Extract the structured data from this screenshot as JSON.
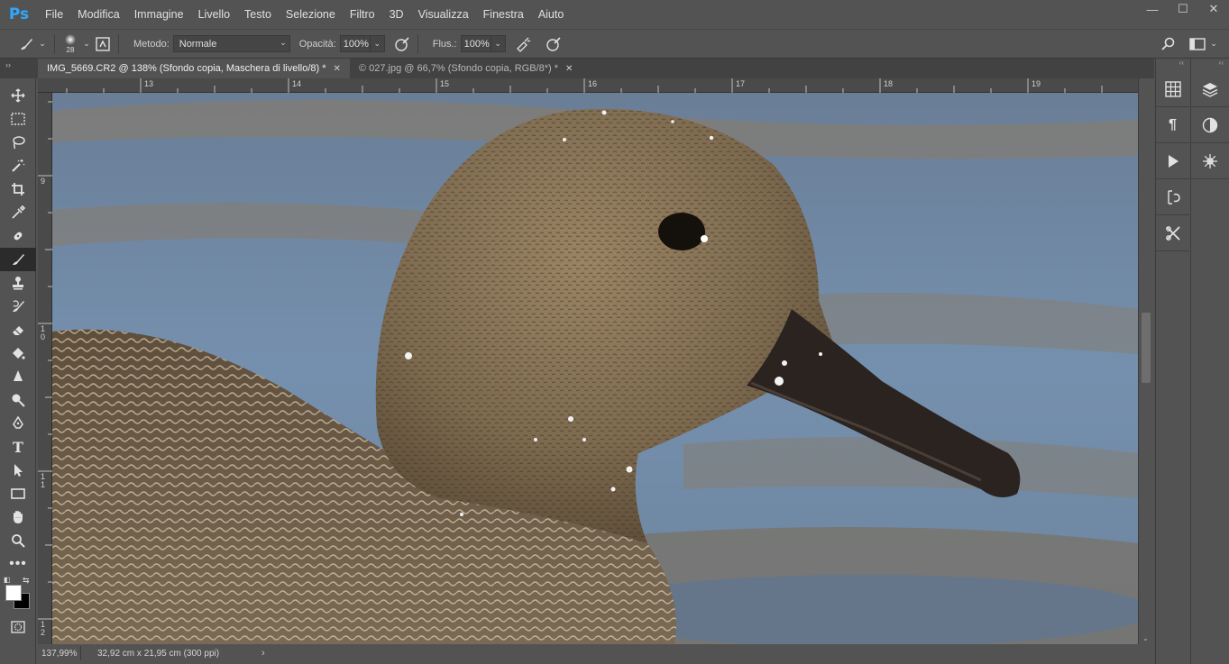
{
  "app": {
    "logo": "Ps",
    "menu": [
      "File",
      "Modifica",
      "Immagine",
      "Livello",
      "Testo",
      "Selezione",
      "Filtro",
      "3D",
      "Visualizza",
      "Finestra",
      "Aiuto"
    ],
    "window_controls": {
      "minimize": "—",
      "maximize": "☐",
      "close": "✕"
    }
  },
  "options": {
    "brush_size": "28",
    "method_label": "Metodo:",
    "method_value": "Normale",
    "opacity_label": "Opacità:",
    "opacity_value": "100%",
    "flow_label": "Flus.:",
    "flow_value": "100%"
  },
  "tabs": [
    {
      "label": "IMG_5669.CR2 @ 138% (Sfondo copia, Maschera di livello/8) *",
      "active": true
    },
    {
      "label": "© 027.jpg @ 66,7% (Sfondo copia, RGB/8*) *",
      "active": false
    }
  ],
  "rulers": {
    "top": [
      "13",
      "14",
      "15",
      "16",
      "17",
      "18",
      "19"
    ],
    "left": [
      "9",
      "1\n0",
      "1\n1",
      "1\n2"
    ]
  },
  "status": {
    "zoom": "137,99%",
    "doc_info": "32,92 cm x 21,95 cm (300 ppi)"
  },
  "tools": [
    "move-icon",
    "marquee-icon",
    "lasso-icon",
    "magic-wand-icon",
    "crop-icon",
    "eyedropper-icon",
    "healing-icon",
    "brush-icon",
    "stamp-icon",
    "history-brush-icon",
    "eraser-icon",
    "bucket-icon",
    "blur-icon",
    "dodge-icon",
    "pen-icon",
    "type-icon",
    "path-select-icon",
    "rectangle-icon",
    "hand-icon",
    "zoom-icon",
    "more-icon"
  ],
  "colors": {
    "foreground": "#ffffff",
    "background": "#000000",
    "accent": "#31a8ff"
  }
}
